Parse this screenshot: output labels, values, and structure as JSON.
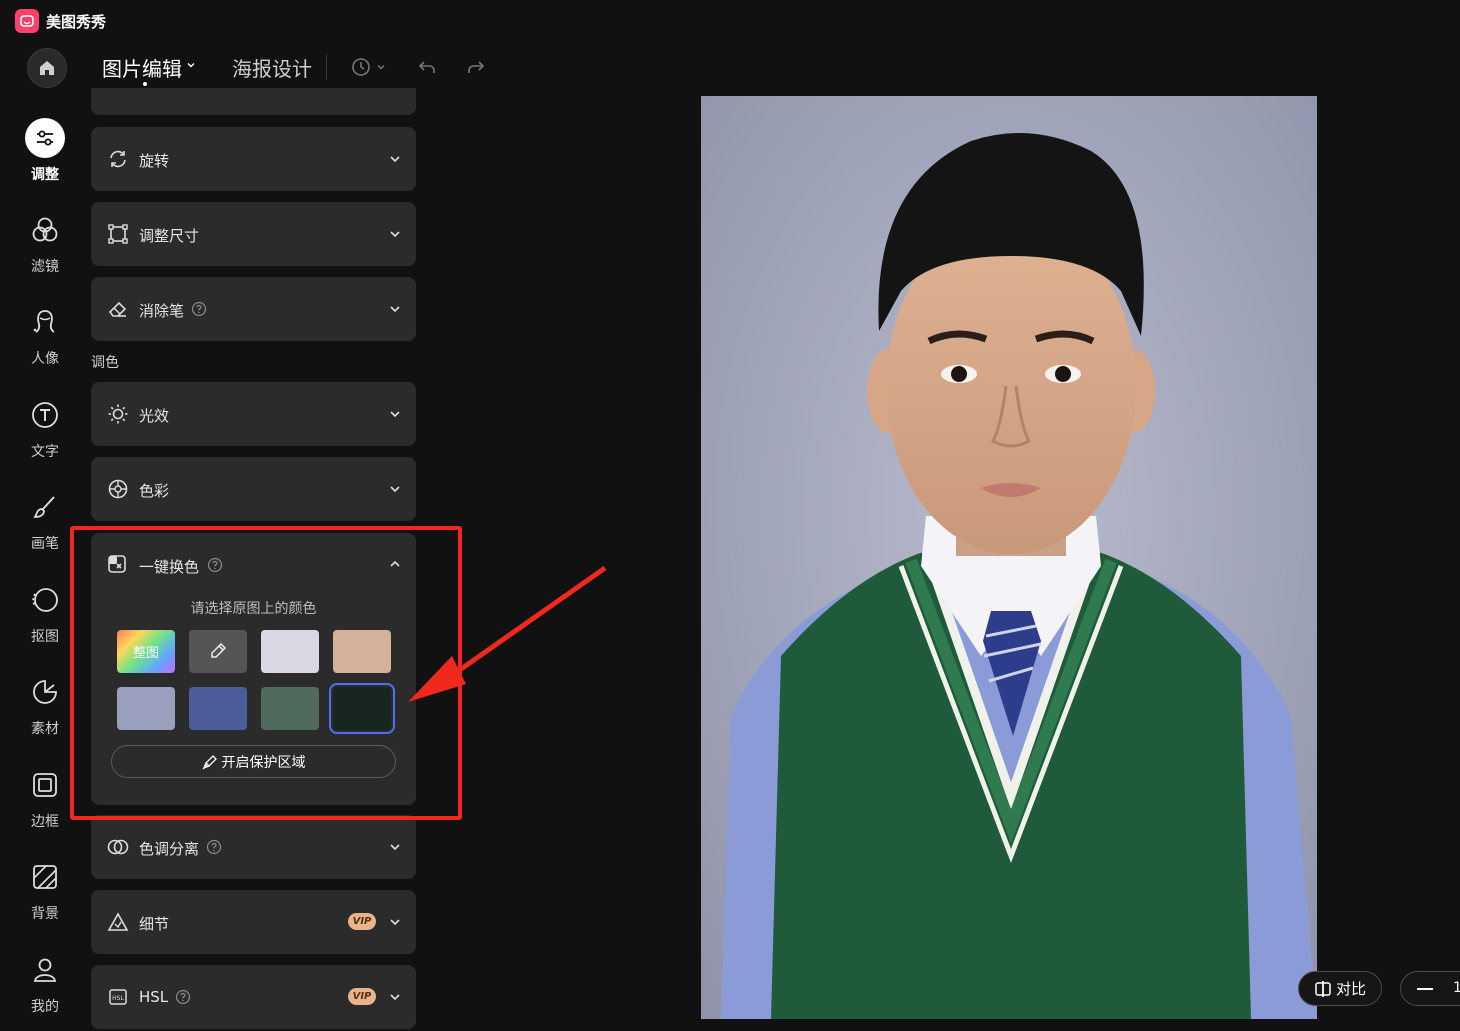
{
  "app": {
    "name": "美图秀秀",
    "logo_icon": "meitu-logo-icon",
    "brand_color": "#ff3f6c"
  },
  "toolbar": {
    "tab_edit_label": "图片编辑",
    "tab_poster_label": "海报设计",
    "icons": [
      "home-icon",
      "history-icon",
      "undo-icon",
      "redo-icon"
    ]
  },
  "nav": {
    "items": [
      {
        "label": "调整",
        "icon": "adjust-icon",
        "active": true
      },
      {
        "label": "滤镜",
        "icon": "filter-icon"
      },
      {
        "label": "人像",
        "icon": "portrait-icon"
      },
      {
        "label": "文字",
        "icon": "text-icon"
      },
      {
        "label": "画笔",
        "icon": "brush-icon"
      },
      {
        "label": "抠图",
        "icon": "cutout-icon"
      },
      {
        "label": "素材",
        "icon": "sticker-icon"
      },
      {
        "label": "边框",
        "icon": "frame-icon"
      },
      {
        "label": "背景",
        "icon": "background-icon"
      },
      {
        "label": "我的",
        "icon": "user-icon"
      }
    ]
  },
  "panel": {
    "cards": [
      {
        "label": "旋转",
        "icon": "rotate-icon"
      },
      {
        "label": "调整尺寸",
        "icon": "resize-icon"
      },
      {
        "label": "消除笔",
        "icon": "eraser-icon",
        "help": true
      },
      {
        "label": "光效",
        "icon": "light-icon"
      },
      {
        "label": "色彩",
        "icon": "color-icon"
      },
      {
        "label": "色调分离",
        "icon": "split-tone-icon",
        "help": true
      },
      {
        "label": "细节",
        "icon": "detail-icon",
        "vip": true
      },
      {
        "label": "HSL",
        "icon": "hsl-icon",
        "help": true,
        "vip": true
      }
    ],
    "section_tone_label": "调色",
    "vip_label": "VIP",
    "one_click": {
      "title": "一键换色",
      "hint": "请选择原图上的颜色",
      "whole_label": "整图",
      "swatches": [
        "#d9d9e3",
        "#d4b29a",
        "#9a9fbd",
        "#4c5c9a",
        "#4f6b5e",
        "#17261f"
      ],
      "selected_index": 5,
      "protect_label": "开启保护区域"
    }
  },
  "canvas": {
    "compare_label": "对比",
    "zoom_text": "1"
  },
  "annotation": {
    "color": "#f0281e"
  }
}
